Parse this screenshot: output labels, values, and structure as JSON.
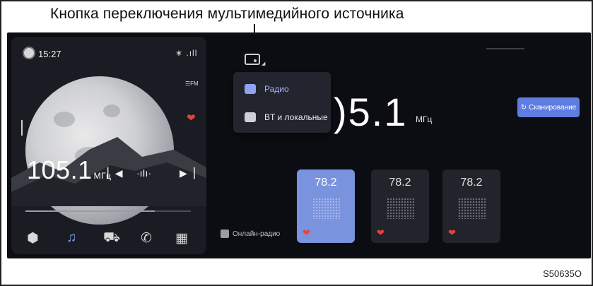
{
  "callout": {
    "title": "Кнопка переключения мультимедийного источника"
  },
  "widget": {
    "time": "15:27",
    "status_icons": "∗ .ıll",
    "fm_label": "FM",
    "frequency": "105.1",
    "frequency_unit": "МГц",
    "progress_fraction": 0.78,
    "dock": [
      "cube-icon",
      "music-icon",
      "car-icon",
      "phone-icon",
      "apps-icon"
    ]
  },
  "source_menu": {
    "items": [
      {
        "label": "Радио",
        "icon": "radio-icon",
        "selected": true
      },
      {
        "label": "BT и локальные",
        "icon": "bluetooth-icon",
        "selected": false
      }
    ]
  },
  "main": {
    "frequency": ")5.1",
    "frequency_unit": "МГц",
    "scan_label": "Сканирование",
    "online_label": "Онлайн-радио",
    "presets": [
      {
        "value": "78.2",
        "favorite": true,
        "active": true
      },
      {
        "value": "78.2",
        "favorite": true,
        "active": false
      },
      {
        "value": "78.2",
        "favorite": true,
        "active": false
      }
    ]
  },
  "figure_code": "S50635O",
  "colors": {
    "accent": "#7a93de",
    "heart": "#e6433c",
    "screen_bg": "#0c0d12"
  }
}
